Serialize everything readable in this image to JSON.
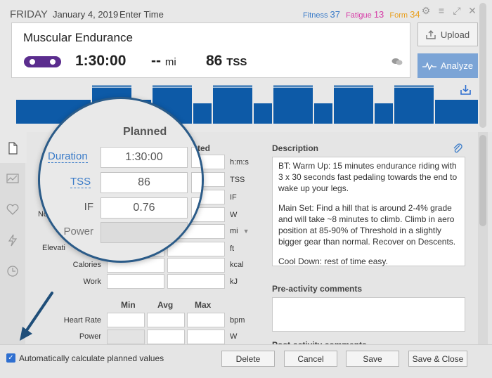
{
  "header": {
    "day": "FRIDAY",
    "date": "January 4, 2019",
    "enter_time": "Enter Time",
    "fitness": {
      "label": "Fitness",
      "value": "37",
      "color": "#3a7bc8"
    },
    "fatigue": {
      "label": "Fatigue",
      "value": "13",
      "color": "#d63aa6"
    },
    "form": {
      "label": "Form",
      "value": "34",
      "color": "#e8a020"
    }
  },
  "workout": {
    "title": "Muscular Endurance",
    "duration": "1:30:00",
    "distance": "--",
    "distance_unit": "mi",
    "tss": "86",
    "tss_unit": "TSS"
  },
  "buttons": {
    "upload": "Upload",
    "analyze": "Analyze",
    "delete": "Delete",
    "cancel": "Cancel",
    "save": "Save",
    "save_close": "Save & Close"
  },
  "chart_data": {
    "type": "bar",
    "values": [
      1,
      1.6,
      1,
      1.6,
      0.85,
      1.6,
      0.85,
      1.6,
      0.85,
      1.6,
      0.85,
      1.6,
      1
    ],
    "widths": [
      108,
      58,
      28,
      58,
      28,
      58,
      28,
      58,
      28,
      58,
      28,
      58,
      70
    ]
  },
  "planned": {
    "header": "Planned",
    "completed_header": "leted",
    "duration_label": "Duration",
    "duration_value": "1:30:00",
    "tss_label": "TSS",
    "tss_value": "86",
    "if_label": "IF",
    "if_value": "0.76",
    "power_label": "Power"
  },
  "rows": {
    "np_label": "No",
    "elevation_label": "Elevati",
    "calories_label": "Calories",
    "work_label": "Work",
    "heart_rate_label": "Heart Rate",
    "power_label": "Power"
  },
  "units": {
    "hms": "h:m:s",
    "tss": "TSS",
    "if": "IF",
    "w": "W",
    "mi": "mi",
    "ft": "ft",
    "kcal": "kcal",
    "kj": "kJ",
    "bpm": "bpm",
    "w2": "W"
  },
  "minmax": {
    "min": "Min",
    "avg": "Avg",
    "max": "Max"
  },
  "description": {
    "title": "Description",
    "p1": "BT: Warm Up: 15 minutes endurance riding with 3 x 30 seconds fast pedaling towards the end to wake up your legs.",
    "p2": "Main Set: Find a hill that is around 2-4% grade and will take ~8 minutes to climb. Climb in aero position at 85-90% of Threshold in a slightly bigger gear than normal. Recover on Descents.",
    "p3": "Cool Down: rest of time easy."
  },
  "comments": {
    "pre": "Pre-activity comments",
    "post": "Post-activity comments"
  },
  "auto_calc": "Automatically calculate planned values",
  "colors": {
    "accent": "#0d5aa7",
    "analyze": "#7ba4d6",
    "callout": "#2b5b88"
  }
}
